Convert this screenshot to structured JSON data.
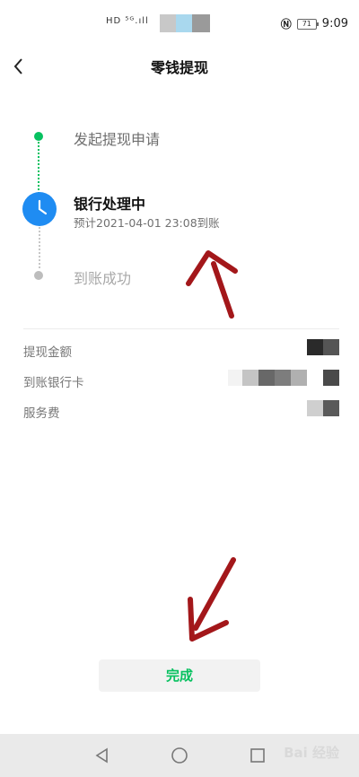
{
  "status_bar": {
    "network": "HD ⁵ᴳ.ıll",
    "battery": "71",
    "time": "9:09"
  },
  "header": {
    "title": "零钱提现",
    "back_icon": "chevron-left-icon"
  },
  "steps": [
    {
      "label": "发起提现申请",
      "state": "done"
    },
    {
      "label": "银行处理中",
      "state": "current",
      "sub": "预计2021-04-01 23:08到账"
    },
    {
      "label": "到账成功",
      "state": "pending"
    }
  ],
  "details": {
    "rows": [
      {
        "label": "提现金额"
      },
      {
        "label": "到账银行卡"
      },
      {
        "label": "服务费"
      }
    ]
  },
  "footer": {
    "done_label": "完成"
  },
  "watermark": "Bai 经验",
  "colors": {
    "accent": "#07c160",
    "processing": "#1f8cf2",
    "annotation_arrow": "#a3171a"
  }
}
